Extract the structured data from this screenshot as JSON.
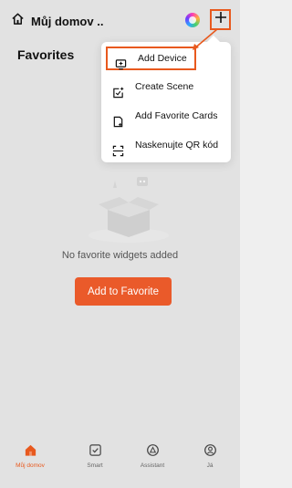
{
  "header": {
    "home_title": "Můj domov ..",
    "favorites_title": "Favorites"
  },
  "menu": {
    "items": [
      {
        "label": "Add Device",
        "icon": "add-device-icon"
      },
      {
        "label": "Create Scene",
        "icon": "create-scene-icon"
      },
      {
        "label": "Add Favorite Cards",
        "icon": "add-card-icon"
      },
      {
        "label": "Naskenujte QR kód",
        "icon": "scan-qr-icon"
      }
    ]
  },
  "empty_state": {
    "message": "No favorite widgets added",
    "button_label": "Add to Favorite"
  },
  "bottom_nav": {
    "items": [
      {
        "label": "Můj domov",
        "icon": "home-icon",
        "active": true
      },
      {
        "label": "Smart",
        "icon": "smart-icon",
        "active": false
      },
      {
        "label": "Assistant",
        "icon": "assistant-icon",
        "active": false
      },
      {
        "label": "Já",
        "icon": "profile-icon",
        "active": false
      }
    ]
  },
  "colors": {
    "accent": "#ea5a2a",
    "highlight": "#e8591e",
    "background": "#efefef"
  }
}
